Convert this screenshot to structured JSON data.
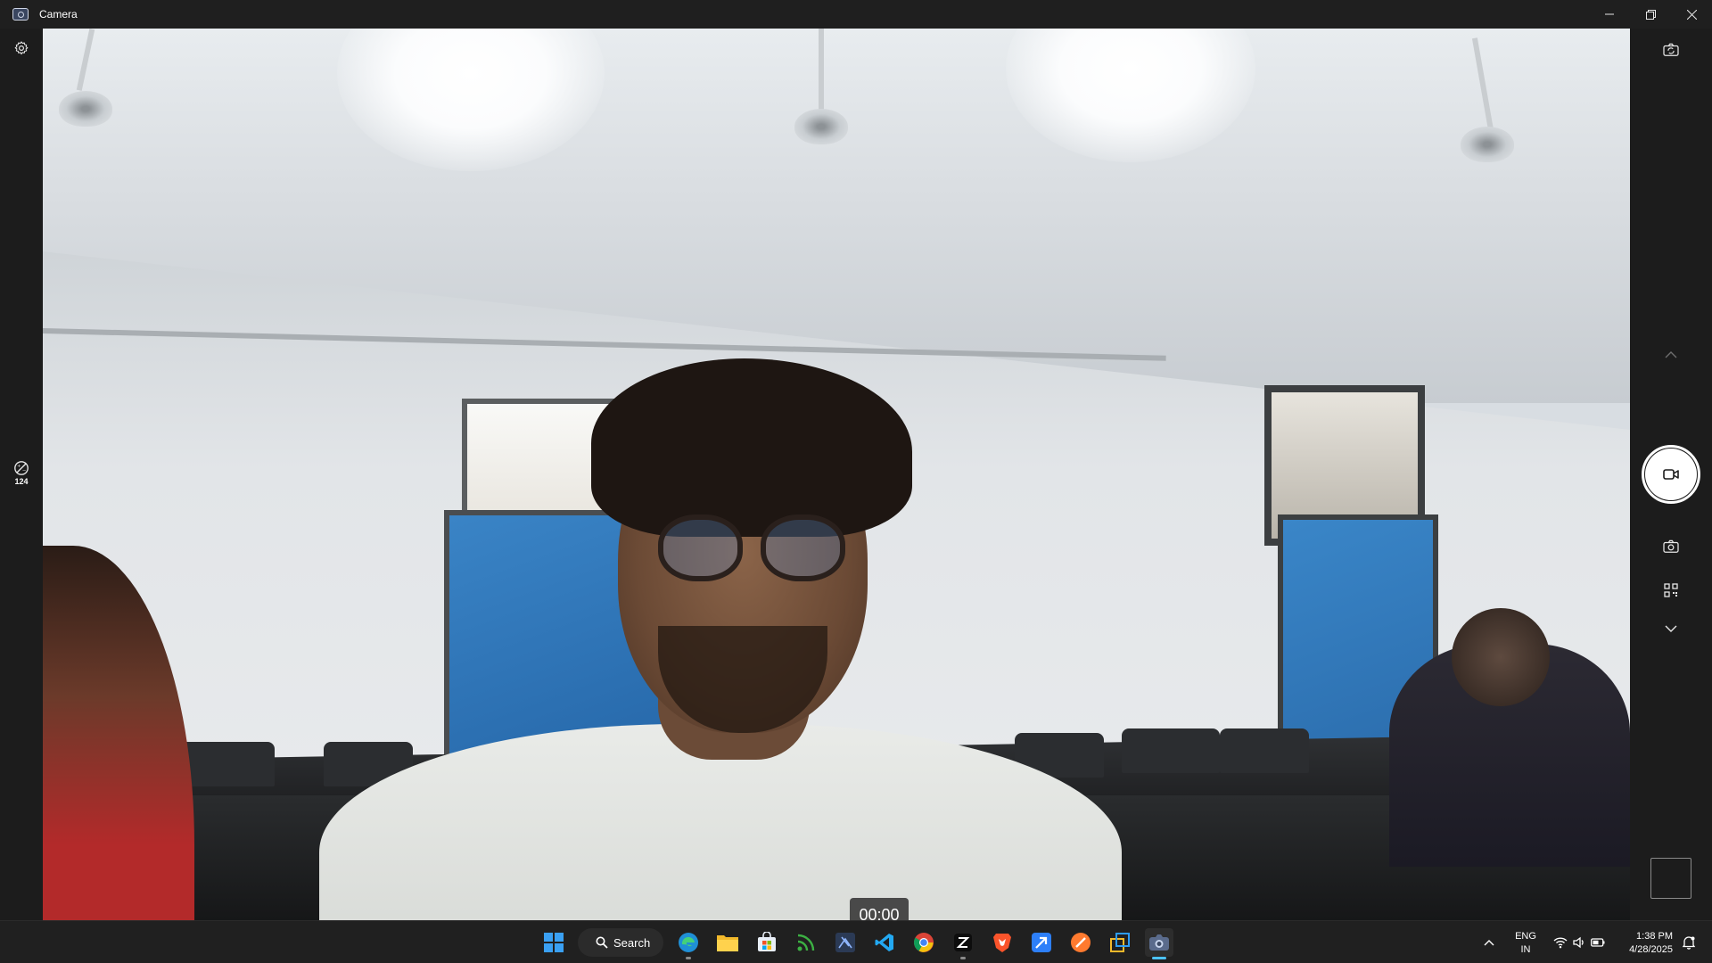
{
  "window": {
    "title": "Camera",
    "controls": [
      "minimize",
      "restore",
      "close"
    ]
  },
  "left_rail": {
    "settings_icon": "gear-icon",
    "hdr_icon": "hdr-icon",
    "hdr_label": "124"
  },
  "viewfinder": {
    "timer": "00:00"
  },
  "right_rail": {
    "buttons": [
      "camera-switch-icon",
      "chevron-up-icon",
      "video-record-icon",
      "photo-mode-icon",
      "qr-scan-icon",
      "chevron-down-icon"
    ],
    "active_mode": "video"
  },
  "taskbar": {
    "search_label": "Search",
    "apps": [
      "start-icon",
      "edge-icon",
      "file-explorer-icon",
      "store-icon",
      "rss-app-icon",
      "snipping-tool-icon",
      "vscode-icon",
      "chrome-icon",
      "app-black-icon",
      "brave-icon",
      "arrow-app-icon",
      "orange-app-icon",
      "remote-desktop-icon",
      "camera-app-icon"
    ],
    "active_app": "camera-app-icon",
    "tray": {
      "lang_line1": "ENG",
      "lang_line2": "IN",
      "time": "1:38 PM",
      "date": "4/28/2025"
    }
  },
  "colors": {
    "accent": "#4cc2ff",
    "chrome_bg": "#1c1c1c",
    "taskbar_bg": "#202020"
  }
}
